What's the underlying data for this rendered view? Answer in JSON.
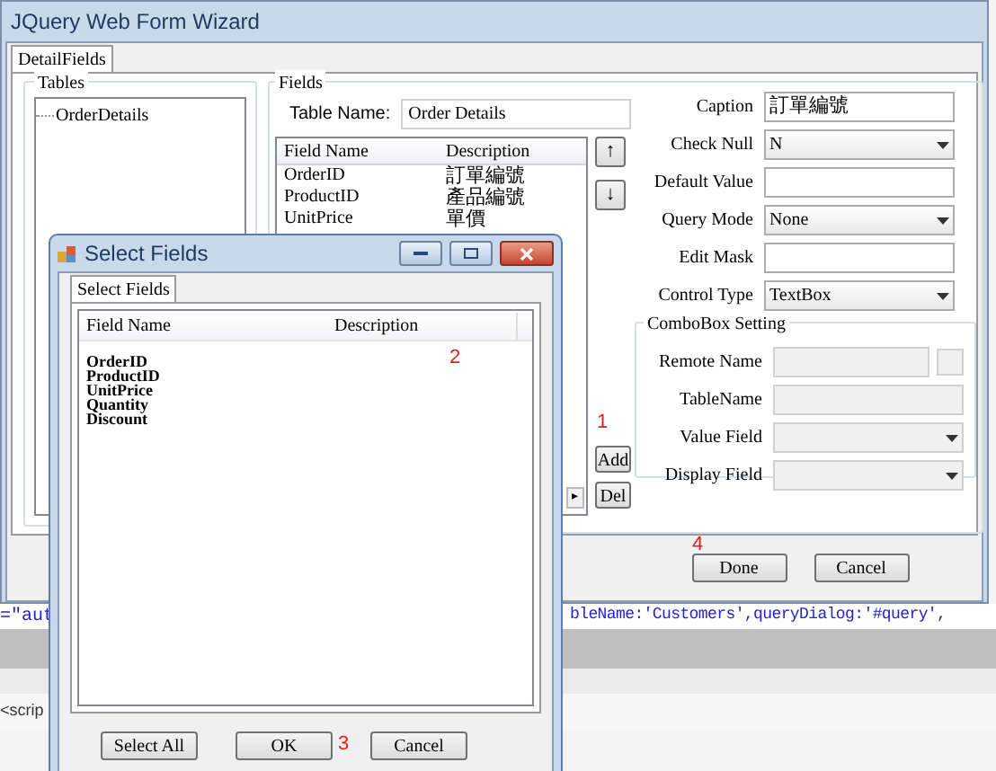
{
  "window": {
    "title": "JQuery Web Form Wizard"
  },
  "tabs": [
    {
      "label": "DetailFields",
      "selected": true
    }
  ],
  "tables": {
    "title": "Tables",
    "items": [
      {
        "label": "OrderDetails"
      }
    ]
  },
  "fields": {
    "title": "Fields",
    "table_name_label": "Table Name:",
    "table_name": "Order Details",
    "grid": {
      "columns": [
        "Field Name",
        "Description"
      ],
      "rows": [
        [
          "OrderID",
          "訂單編號"
        ],
        [
          "ProductID",
          "產品編號"
        ],
        [
          "UnitPrice",
          "單價"
        ]
      ]
    },
    "move_buttons": [
      "↑",
      "↓"
    ],
    "add": "Add",
    "del": "Del",
    "scroll_arrow": "▸",
    "properties": [
      {
        "kind": "text",
        "label": "Caption",
        "value": "訂單編號"
      },
      {
        "kind": "select",
        "label": "Check Null",
        "value": "N"
      },
      {
        "kind": "text",
        "label": "Default Value"
      },
      {
        "kind": "select",
        "label": "Query Mode",
        "value": "None"
      },
      {
        "kind": "text",
        "label": "Edit Mask"
      },
      {
        "kind": "select",
        "label": "Control Type",
        "value": "TextBox"
      }
    ],
    "combobox_setting": {
      "title": "ComboBox Setting",
      "rows": [
        {
          "kind": "text_button",
          "label": "Remote Name",
          "disabled": true
        },
        {
          "kind": "text",
          "label": "TableName",
          "disabled": true
        },
        {
          "kind": "select",
          "label": "Value Field",
          "disabled": true
        },
        {
          "kind": "select",
          "label": "Display Field",
          "disabled": true
        }
      ]
    }
  },
  "buttons": [
    "Done",
    "Cancel"
  ],
  "editor": {
    "line_left": "=\"aut",
    "line_right": "bleName:'Customers',queryDialog:'#query',",
    "line_2": "<scrip"
  },
  "dialog": {
    "title": "Select Fields",
    "tabs": [
      {
        "label": "Select Fields",
        "selected": true
      }
    ],
    "columns": [
      "Field Name",
      "Description"
    ],
    "items": [
      "OrderID",
      "ProductID",
      "UnitPrice",
      "Quantity",
      "Discount"
    ],
    "buttons": [
      "Select All",
      "OK",
      "Cancel"
    ]
  },
  "annotations": [
    "1",
    "2",
    "3",
    "4"
  ]
}
